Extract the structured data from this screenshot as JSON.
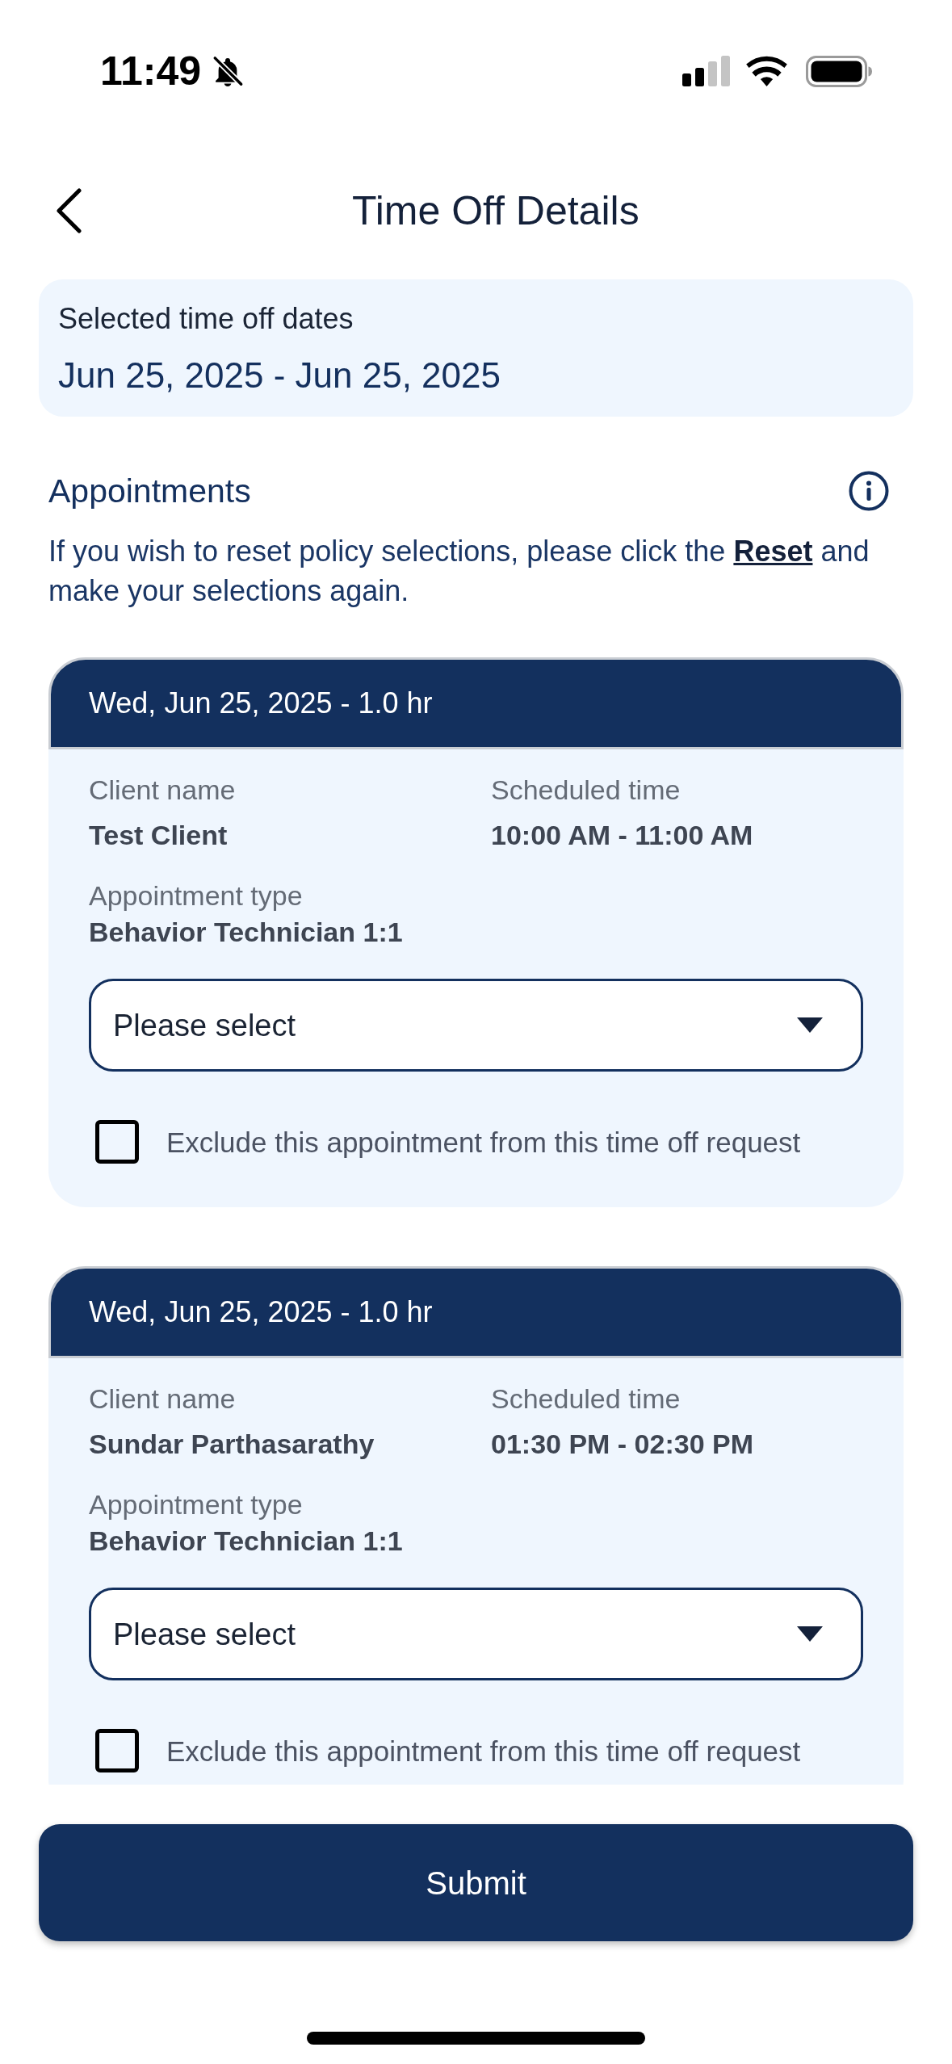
{
  "status_bar": {
    "time": "11:49"
  },
  "header": {
    "title": "Time Off Details"
  },
  "selected_dates": {
    "label": "Selected time off dates",
    "value": "Jun 25, 2025 - Jun 25, 2025"
  },
  "appointments": {
    "title": "Appointments",
    "note": {
      "before": "If you wish to reset policy selections, please click the",
      "link": "Reset",
      "after": "and make your selections again."
    },
    "cards": [
      {
        "heading": "Wed, Jun 25, 2025 - 1.0 hr",
        "client": {
          "label": "Client name",
          "value": "Test Client"
        },
        "scheduled_time": {
          "label": "Scheduled time",
          "value": "10:00 AM - 11:00 AM"
        },
        "appointment_type": {
          "label": "Appointment type",
          "value": "Behavior Technician 1:1"
        },
        "policy_select": {
          "placeholder": "Please select"
        },
        "exclude": {
          "label": "Exclude this appointment from this time off request",
          "checked": false
        }
      },
      {
        "heading": "Wed, Jun 25, 2025 - 1.0 hr",
        "client": {
          "label": "Client name",
          "value": "Sundar Parthasarathy"
        },
        "scheduled_time": {
          "label": "Scheduled time",
          "value": "01:30 PM - 02:30 PM"
        },
        "appointment_type": {
          "label": "Appointment type",
          "value": "Behavior Technician 1:1"
        },
        "policy_select": {
          "placeholder": "Please select"
        },
        "exclude": {
          "label": "Exclude this appointment from this time off request",
          "checked": false
        }
      }
    ]
  },
  "submit_button": "Submit"
}
